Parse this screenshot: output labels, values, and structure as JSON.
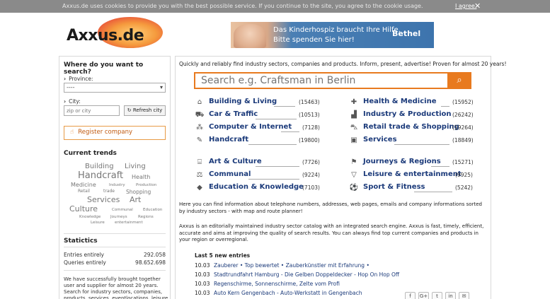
{
  "cookie": {
    "text": "Axxus.de uses cookies to provide you with the best possible service. If you continue to the site, you agree to the cookie usage.",
    "agree": "I agree.",
    "close": "✕"
  },
  "logo": {
    "text": "Axxus.de"
  },
  "banner": {
    "line1": "Das Kinderhospiz braucht Ihre Hilfe.",
    "line2": "Bitte spenden Sie hier!",
    "brand": "Bethel"
  },
  "sidebar": {
    "title": "Where do you want to search?",
    "province_label": "Province:",
    "province_value": "----",
    "city_label": "City:",
    "city_placeholder": "zip or city",
    "refresh_label": "Refresh city",
    "register_label": "Register company",
    "trends_title": "Current trends",
    "trends": [
      "Building",
      "Living",
      "Handcraft",
      "Health",
      "Medicine",
      "Industry",
      "Production",
      "Retail",
      "trade",
      "Shopping",
      "Services",
      "Art",
      "Culture",
      "Communal",
      "Education",
      "Knowledge",
      "Journeys",
      "Regions",
      "Leisure",
      "entertainment"
    ],
    "stats_title": "Statictics",
    "stats": [
      {
        "label": "Entries entirely",
        "value": "292.058"
      },
      {
        "label": "Queries entirely",
        "value": "98.652.698"
      }
    ],
    "about": "We have successfully brought together user and supplier for almost 20 years. Search for industry sectors, companies, products, services, eventlocations, leisure and sports"
  },
  "main": {
    "intro": "Quickly and reliably find industry sectors, companies and products. Inform, present, advertise! Proven for almost 20 years!",
    "search_placeholder": "Search e.g. Craftsman in Berlin",
    "categories": [
      {
        "label": "Building & Living",
        "count": "(15463)",
        "icon": "house-icon"
      },
      {
        "label": "Health & Medicine",
        "count": "(15952)",
        "icon": "medkit-icon"
      },
      {
        "label": "Car & Traffic",
        "count": "(10513)",
        "icon": "car-icon"
      },
      {
        "label": "Industry & Production",
        "count": "(26242)",
        "icon": "factory-icon"
      },
      {
        "label": "Computer & Internet",
        "count": "(7128)",
        "icon": "network-icon"
      },
      {
        "label": "Retail trade & Shopping",
        "count": "(19264)",
        "icon": "cart-icon"
      },
      {
        "label": "Handcraft",
        "count": "(19800)",
        "icon": "wrench-icon"
      },
      {
        "label": "Services",
        "count": "(18849)",
        "icon": "briefcase-icon"
      },
      {
        "label": "Art & Culture",
        "count": "(7726)",
        "icon": "museum-icon"
      },
      {
        "label": "Journeys & Regions",
        "count": "(15271)",
        "icon": "signpost-icon"
      },
      {
        "label": "Communal",
        "count": "(9224)",
        "icon": "scales-icon"
      },
      {
        "label": "Leisure & entertainment",
        "count": "(9925)",
        "icon": "cocktail-icon"
      },
      {
        "label": "Education & Knowledge",
        "count": "(7103)",
        "icon": "graduation-cap-icon"
      },
      {
        "label": "Sport & Fitness",
        "count": "(5242)",
        "icon": "football-icon"
      }
    ],
    "para1": "Here you can find information about telephone numbers, addresses, web pages, emails and company informations sorted by industry sectors - with map and route planner!",
    "para2": "Axxus is an editorially maintained industry sector catalog with an integrated search engine. Axxus is fast, timely, efficient, accurate and aims at improving the quality of search results. You can always find top current companies and products in your region or overregional.",
    "new_title": "Last 5 new entries",
    "new_entries": [
      {
        "date": "10.03",
        "text": "Zauberer • Top bewertet • Zauberkünstler mit Erfahrung •"
      },
      {
        "date": "10.03",
        "text": "Stadtrundfahrt Hamburg - Die Gelben Doppeldecker - Hop On Hop Off"
      },
      {
        "date": "10.03",
        "text": "Regenschirme, Sonnenschirme, Zelte vom Profi"
      },
      {
        "date": "10.03",
        "text": "Auto Kern Gengenbach - Auto-Werkstatt in Gengenbach"
      }
    ]
  },
  "social": [
    "f",
    "G+",
    "t",
    "in",
    "✉"
  ]
}
